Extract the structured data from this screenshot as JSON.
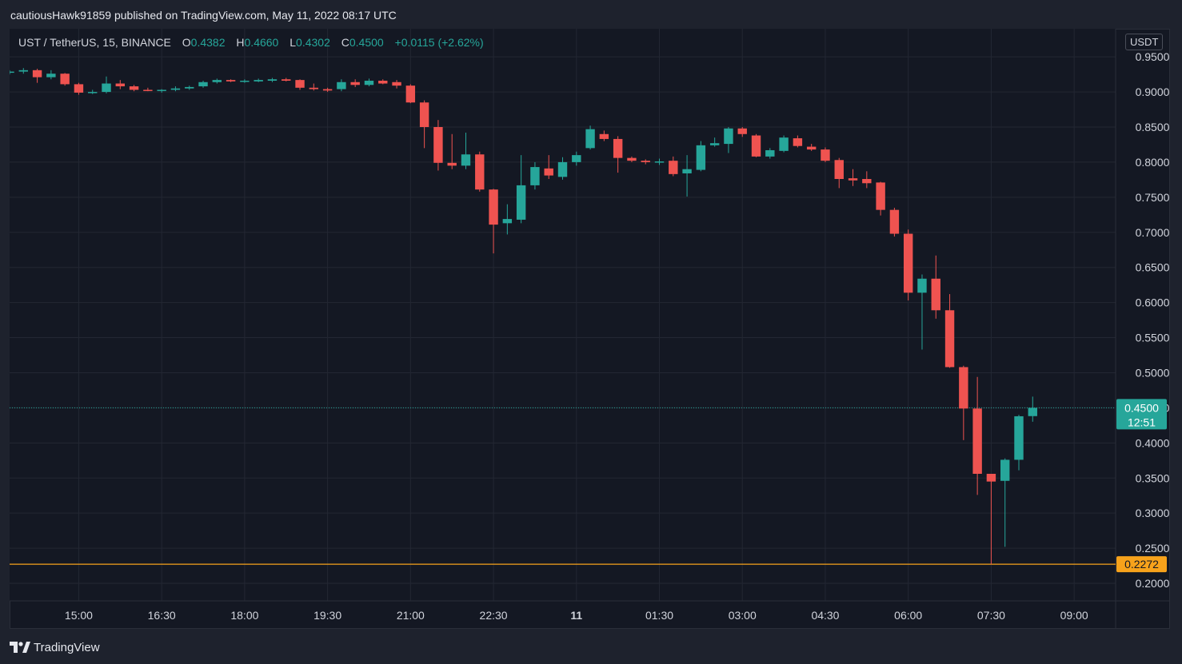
{
  "header": {
    "published_text": "cautiousHawk91859 published on TradingView.com, May 11, 2022 08:17 UTC"
  },
  "legend": {
    "symbol": "UST / TetherUS, 15, BINANCE",
    "o_label": "O",
    "o_value": "0.4382",
    "h_label": "H",
    "h_value": "0.4660",
    "l_label": "L",
    "l_value": "0.4302",
    "c_label": "C",
    "c_value": "0.4500",
    "change": "+0.0115 (+2.62%)"
  },
  "currency_badge": "USDT",
  "footer": {
    "brand": "TradingView",
    "logo_icon": "tradingview-logo-icon"
  },
  "colors": {
    "up": "#26a69a",
    "down": "#ef5350",
    "grid": "#232733",
    "support_line": "#f7a21b",
    "background": "#141823",
    "axis_text": "#d1d4dc"
  },
  "price_badges": {
    "last_price": "0.4500",
    "countdown": "12:51",
    "support_price": "0.2272"
  },
  "chart_data": {
    "type": "candlestick",
    "symbol": "UST / TetherUS",
    "interval": "15",
    "exchange": "BINANCE",
    "y_ticks": [
      "0.9500",
      "0.9000",
      "0.8500",
      "0.8000",
      "0.7500",
      "0.7000",
      "0.6500",
      "0.6000",
      "0.5500",
      "0.5000",
      "0.4500",
      "0.4000",
      "0.3500",
      "0.3000",
      "0.2500",
      "0.2000"
    ],
    "x_ticks": [
      "15:00",
      "16:30",
      "18:00",
      "19:30",
      "21:00",
      "22:30",
      "11",
      "01:30",
      "03:00",
      "04:30",
      "06:00",
      "07:30",
      "09:00"
    ],
    "x_tick_times": [
      "2022-05-10 15:00",
      "2022-05-10 16:30",
      "2022-05-10 18:00",
      "2022-05-10 19:30",
      "2022-05-10 21:00",
      "2022-05-10 22:30",
      "2022-05-11 00:00",
      "2022-05-11 01:30",
      "2022-05-11 03:00",
      "2022-05-11 04:30",
      "2022-05-11 06:00",
      "2022-05-11 07:30",
      "2022-05-11 09:00"
    ],
    "ylim": [
      0.175,
      0.99
    ],
    "xlim": [
      "2022-05-10 13:45",
      "2022-05-11 09:45"
    ],
    "grid": true,
    "horizontal_line": {
      "price": 0.2272,
      "color": "#f7a21b"
    },
    "last_price_line": 0.45,
    "candles": [
      {
        "t": "2022-05-10 13:45",
        "o": 0.928,
        "h": 0.931,
        "l": 0.925,
        "c": 0.929
      },
      {
        "t": "2022-05-10 14:00",
        "o": 0.929,
        "h": 0.934,
        "l": 0.926,
        "c": 0.931
      },
      {
        "t": "2022-05-10 14:15",
        "o": 0.931,
        "h": 0.933,
        "l": 0.913,
        "c": 0.921
      },
      {
        "t": "2022-05-10 14:30",
        "o": 0.921,
        "h": 0.931,
        "l": 0.918,
        "c": 0.926
      },
      {
        "t": "2022-05-10 14:45",
        "o": 0.926,
        "h": 0.927,
        "l": 0.909,
        "c": 0.911
      },
      {
        "t": "2022-05-10 15:00",
        "o": 0.911,
        "h": 0.913,
        "l": 0.896,
        "c": 0.899
      },
      {
        "t": "2022-05-10 15:15",
        "o": 0.899,
        "h": 0.903,
        "l": 0.897,
        "c": 0.9
      },
      {
        "t": "2022-05-10 15:30",
        "o": 0.9,
        "h": 0.922,
        "l": 0.898,
        "c": 0.912
      },
      {
        "t": "2022-05-10 15:45",
        "o": 0.912,
        "h": 0.917,
        "l": 0.904,
        "c": 0.908
      },
      {
        "t": "2022-05-10 16:00",
        "o": 0.908,
        "h": 0.91,
        "l": 0.901,
        "c": 0.903
      },
      {
        "t": "2022-05-10 16:15",
        "o": 0.903,
        "h": 0.906,
        "l": 0.901,
        "c": 0.902
      },
      {
        "t": "2022-05-10 16:30",
        "o": 0.902,
        "h": 0.904,
        "l": 0.899,
        "c": 0.903
      },
      {
        "t": "2022-05-10 16:45",
        "o": 0.903,
        "h": 0.908,
        "l": 0.901,
        "c": 0.905
      },
      {
        "t": "2022-05-10 17:00",
        "o": 0.905,
        "h": 0.909,
        "l": 0.903,
        "c": 0.907
      },
      {
        "t": "2022-05-10 17:15",
        "o": 0.908,
        "h": 0.916,
        "l": 0.906,
        "c": 0.914
      },
      {
        "t": "2022-05-10 17:30",
        "o": 0.914,
        "h": 0.919,
        "l": 0.912,
        "c": 0.917
      },
      {
        "t": "2022-05-10 17:45",
        "o": 0.917,
        "h": 0.918,
        "l": 0.914,
        "c": 0.915
      },
      {
        "t": "2022-05-10 18:00",
        "o": 0.915,
        "h": 0.918,
        "l": 0.913,
        "c": 0.916
      },
      {
        "t": "2022-05-10 18:15",
        "o": 0.915,
        "h": 0.919,
        "l": 0.914,
        "c": 0.917
      },
      {
        "t": "2022-05-10 18:30",
        "o": 0.916,
        "h": 0.92,
        "l": 0.914,
        "c": 0.918
      },
      {
        "t": "2022-05-10 18:45",
        "o": 0.918,
        "h": 0.92,
        "l": 0.915,
        "c": 0.916
      },
      {
        "t": "2022-05-10 19:00",
        "o": 0.917,
        "h": 0.918,
        "l": 0.903,
        "c": 0.906
      },
      {
        "t": "2022-05-10 19:15",
        "o": 0.906,
        "h": 0.912,
        "l": 0.902,
        "c": 0.904
      },
      {
        "t": "2022-05-10 19:30",
        "o": 0.904,
        "h": 0.906,
        "l": 0.9,
        "c": 0.902
      },
      {
        "t": "2022-05-10 19:45",
        "o": 0.904,
        "h": 0.918,
        "l": 0.901,
        "c": 0.914
      },
      {
        "t": "2022-05-10 20:00",
        "o": 0.914,
        "h": 0.918,
        "l": 0.907,
        "c": 0.91
      },
      {
        "t": "2022-05-10 20:15",
        "o": 0.91,
        "h": 0.919,
        "l": 0.908,
        "c": 0.916
      },
      {
        "t": "2022-05-10 20:30",
        "o": 0.916,
        "h": 0.918,
        "l": 0.911,
        "c": 0.912
      },
      {
        "t": "2022-05-10 20:45",
        "o": 0.914,
        "h": 0.917,
        "l": 0.905,
        "c": 0.909
      },
      {
        "t": "2022-05-10 21:00",
        "o": 0.909,
        "h": 0.911,
        "l": 0.884,
        "c": 0.885
      },
      {
        "t": "2022-05-10 21:15",
        "o": 0.885,
        "h": 0.888,
        "l": 0.82,
        "c": 0.85
      },
      {
        "t": "2022-05-10 21:30",
        "o": 0.85,
        "h": 0.86,
        "l": 0.788,
        "c": 0.799
      },
      {
        "t": "2022-05-10 21:45",
        "o": 0.799,
        "h": 0.84,
        "l": 0.79,
        "c": 0.795
      },
      {
        "t": "2022-05-10 22:00",
        "o": 0.795,
        "h": 0.842,
        "l": 0.79,
        "c": 0.811
      },
      {
        "t": "2022-05-10 22:15",
        "o": 0.811,
        "h": 0.815,
        "l": 0.758,
        "c": 0.761
      },
      {
        "t": "2022-05-10 22:30",
        "o": 0.761,
        "h": 0.762,
        "l": 0.67,
        "c": 0.711
      },
      {
        "t": "2022-05-10 22:45",
        "o": 0.713,
        "h": 0.74,
        "l": 0.697,
        "c": 0.719
      },
      {
        "t": "2022-05-10 23:00",
        "o": 0.718,
        "h": 0.81,
        "l": 0.713,
        "c": 0.767
      },
      {
        "t": "2022-05-10 23:15",
        "o": 0.767,
        "h": 0.8,
        "l": 0.761,
        "c": 0.793
      },
      {
        "t": "2022-05-10 23:30",
        "o": 0.791,
        "h": 0.81,
        "l": 0.776,
        "c": 0.781
      },
      {
        "t": "2022-05-10 23:45",
        "o": 0.779,
        "h": 0.807,
        "l": 0.775,
        "c": 0.8
      },
      {
        "t": "2022-05-11 00:00",
        "o": 0.8,
        "h": 0.815,
        "l": 0.795,
        "c": 0.81
      },
      {
        "t": "2022-05-11 00:15",
        "o": 0.82,
        "h": 0.852,
        "l": 0.818,
        "c": 0.847
      },
      {
        "t": "2022-05-11 00:30",
        "o": 0.84,
        "h": 0.845,
        "l": 0.83,
        "c": 0.833
      },
      {
        "t": "2022-05-11 00:45",
        "o": 0.833,
        "h": 0.837,
        "l": 0.785,
        "c": 0.806
      },
      {
        "t": "2022-05-11 01:00",
        "o": 0.806,
        "h": 0.808,
        "l": 0.8,
        "c": 0.802
      },
      {
        "t": "2022-05-11 01:15",
        "o": 0.802,
        "h": 0.804,
        "l": 0.797,
        "c": 0.8
      },
      {
        "t": "2022-05-11 01:30",
        "o": 0.8,
        "h": 0.805,
        "l": 0.796,
        "c": 0.801
      },
      {
        "t": "2022-05-11 01:45",
        "o": 0.802,
        "h": 0.808,
        "l": 0.78,
        "c": 0.783
      },
      {
        "t": "2022-05-11 02:00",
        "o": 0.784,
        "h": 0.81,
        "l": 0.751,
        "c": 0.79
      },
      {
        "t": "2022-05-11 02:15",
        "o": 0.789,
        "h": 0.83,
        "l": 0.787,
        "c": 0.824
      },
      {
        "t": "2022-05-11 02:30",
        "o": 0.824,
        "h": 0.835,
        "l": 0.822,
        "c": 0.827
      },
      {
        "t": "2022-05-11 02:45",
        "o": 0.826,
        "h": 0.85,
        "l": 0.813,
        "c": 0.848
      },
      {
        "t": "2022-05-11 03:00",
        "o": 0.848,
        "h": 0.85,
        "l": 0.836,
        "c": 0.84
      },
      {
        "t": "2022-05-11 03:15",
        "o": 0.838,
        "h": 0.84,
        "l": 0.807,
        "c": 0.808
      },
      {
        "t": "2022-05-11 03:30",
        "o": 0.808,
        "h": 0.82,
        "l": 0.805,
        "c": 0.817
      },
      {
        "t": "2022-05-11 03:45",
        "o": 0.816,
        "h": 0.838,
        "l": 0.814,
        "c": 0.835
      },
      {
        "t": "2022-05-11 04:00",
        "o": 0.834,
        "h": 0.838,
        "l": 0.821,
        "c": 0.823
      },
      {
        "t": "2022-05-11 04:15",
        "o": 0.822,
        "h": 0.826,
        "l": 0.816,
        "c": 0.818
      },
      {
        "t": "2022-05-11 04:30",
        "o": 0.818,
        "h": 0.821,
        "l": 0.8,
        "c": 0.802
      },
      {
        "t": "2022-05-11 04:45",
        "o": 0.803,
        "h": 0.806,
        "l": 0.763,
        "c": 0.776
      },
      {
        "t": "2022-05-11 05:00",
        "o": 0.777,
        "h": 0.79,
        "l": 0.766,
        "c": 0.774
      },
      {
        "t": "2022-05-11 05:15",
        "o": 0.776,
        "h": 0.787,
        "l": 0.763,
        "c": 0.77
      },
      {
        "t": "2022-05-11 05:30",
        "o": 0.771,
        "h": 0.772,
        "l": 0.724,
        "c": 0.732
      },
      {
        "t": "2022-05-11 05:45",
        "o": 0.732,
        "h": 0.735,
        "l": 0.694,
        "c": 0.698
      },
      {
        "t": "2022-05-11 06:00",
        "o": 0.698,
        "h": 0.704,
        "l": 0.603,
        "c": 0.614
      },
      {
        "t": "2022-05-11 06:15",
        "o": 0.614,
        "h": 0.64,
        "l": 0.533,
        "c": 0.634
      },
      {
        "t": "2022-05-11 06:30",
        "o": 0.634,
        "h": 0.667,
        "l": 0.577,
        "c": 0.589
      },
      {
        "t": "2022-05-11 06:45",
        "o": 0.589,
        "h": 0.612,
        "l": 0.507,
        "c": 0.508
      },
      {
        "t": "2022-05-11 07:00",
        "o": 0.508,
        "h": 0.51,
        "l": 0.404,
        "c": 0.449
      },
      {
        "t": "2022-05-11 07:15",
        "o": 0.449,
        "h": 0.494,
        "l": 0.326,
        "c": 0.356
      },
      {
        "t": "2022-05-11 07:30",
        "o": 0.356,
        "h": 0.344,
        "l": 0.2272,
        "c": 0.345
      },
      {
        "t": "2022-05-11 07:45",
        "o": 0.346,
        "h": 0.378,
        "l": 0.252,
        "c": 0.376
      },
      {
        "t": "2022-05-11 08:00",
        "o": 0.376,
        "h": 0.44,
        "l": 0.361,
        "c": 0.438
      },
      {
        "t": "2022-05-11 08:15",
        "o": 0.4382,
        "h": 0.466,
        "l": 0.4302,
        "c": 0.45
      }
    ]
  }
}
